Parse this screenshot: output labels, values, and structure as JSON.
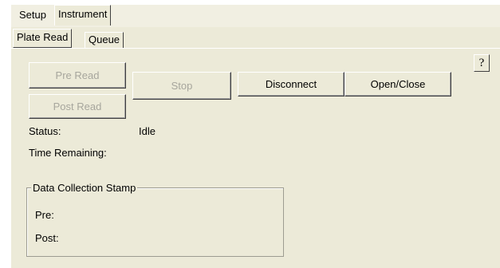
{
  "outer_tabs": [
    {
      "label": "Setup",
      "selected": false
    },
    {
      "label": "Instrument",
      "selected": true
    }
  ],
  "inner_tabs": [
    {
      "label": "Plate Read",
      "selected": true
    },
    {
      "label": "Queue",
      "selected": false
    }
  ],
  "buttons": {
    "pre_read": {
      "label": "Pre Read",
      "enabled": false
    },
    "post_read": {
      "label": "Post Read",
      "enabled": false
    },
    "stop": {
      "label": "Stop",
      "enabled": false
    },
    "disconnect": {
      "label": "Disconnect",
      "enabled": true
    },
    "open_close": {
      "label": "Open/Close",
      "enabled": true
    },
    "help": {
      "label": "?",
      "enabled": true
    }
  },
  "status": {
    "status_label": "Status:",
    "status_value": "Idle",
    "time_remaining_label": "Time Remaining:",
    "time_remaining_value": ""
  },
  "stamp_group": {
    "title": "Data Collection Stamp",
    "pre_label": "Pre:",
    "post_label": "Post:"
  },
  "colors": {
    "panel_bg": "#ecead8",
    "disabled_text": "#a7a69d"
  }
}
